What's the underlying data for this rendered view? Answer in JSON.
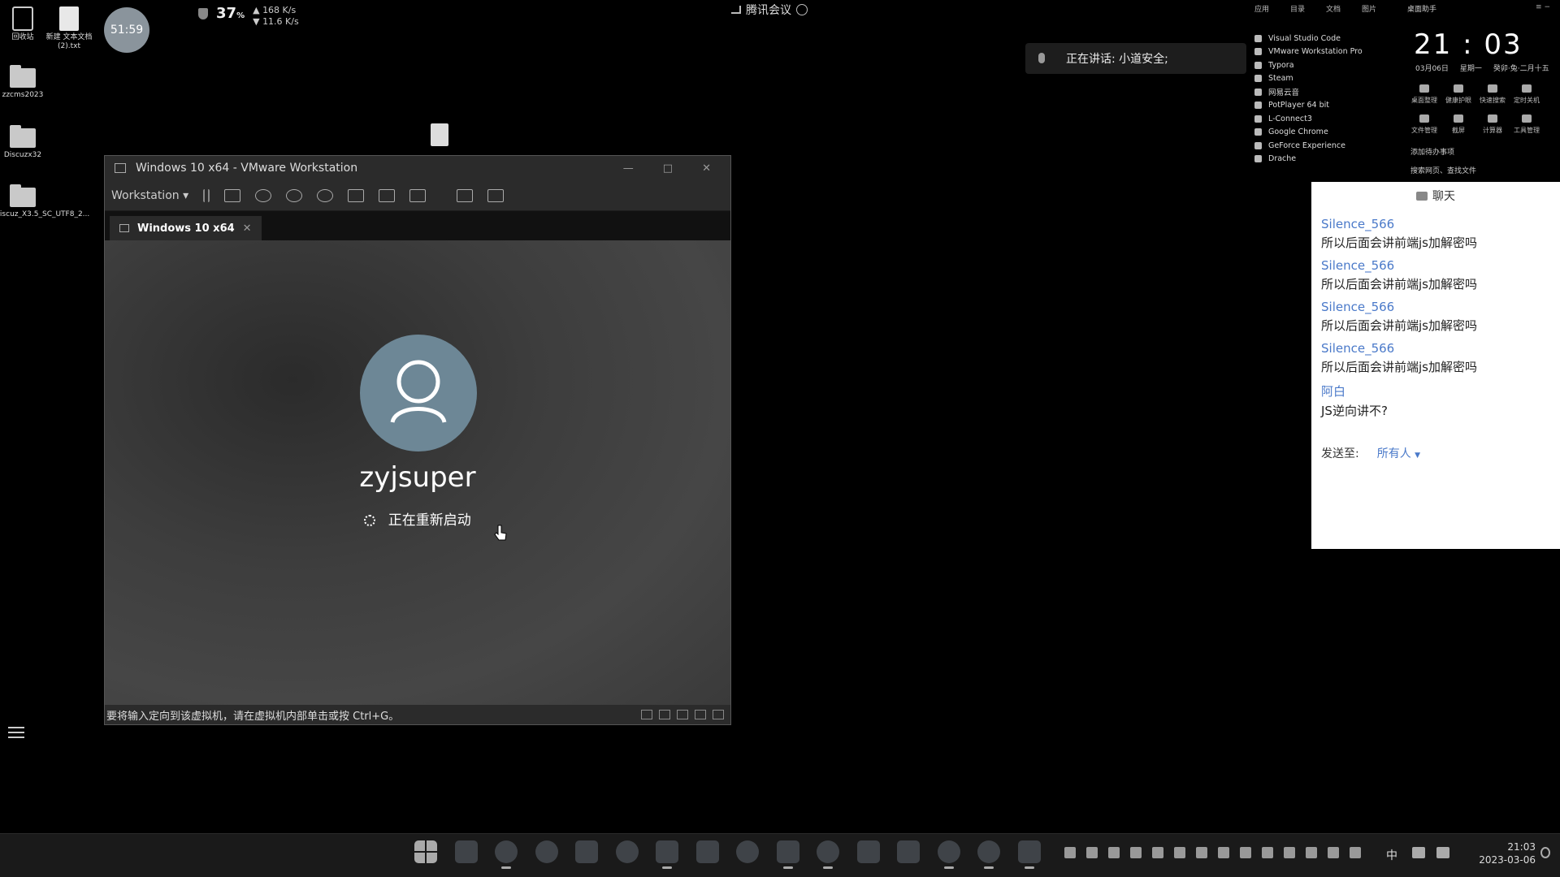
{
  "desktop": {
    "icons": [
      {
        "label": "回收站"
      },
      {
        "label": "新建 文本文档 (2).txt"
      },
      {
        "label": "zzcms2023"
      },
      {
        "label": "Discuzx32"
      },
      {
        "label": "Discuz_X3.5_SC_UTF8_2..."
      }
    ]
  },
  "monitor": {
    "clock_badge": "51:59",
    "cpu_percent": "37",
    "percent_sign": "%",
    "upload": "168 K/s",
    "download": "11.6 K/s"
  },
  "meeting": {
    "app_name": "腾讯会议",
    "speaking": "正在讲话: 小道安全;"
  },
  "applist": {
    "tabs": [
      "应用",
      "目录",
      "文档",
      "图片"
    ],
    "items": [
      "Visual Studio Code",
      "VMware Workstation Pro",
      "Typora",
      "Steam",
      "网易云音",
      "PotPlayer 64 bit",
      "L-Connect3",
      "Google Chrome",
      "GeForce Experience",
      "Drache"
    ]
  },
  "widget": {
    "title": "桌面助手",
    "time": "21 : 03",
    "date": "03月06日",
    "weekday": "星期一",
    "lunar": "癸卯·兔·二月十五",
    "buttons": [
      "桌面整理",
      "健康护眼",
      "快速搜索",
      "定时关机",
      "文件管理",
      "截屏",
      "计算器",
      "工具管理"
    ],
    "todo": "添加待办事项",
    "search": "搜索网页、查找文件"
  },
  "chat": {
    "title": "聊天",
    "messages": [
      {
        "name": "Silence_566",
        "text": "所以后面会讲前端js加解密吗"
      },
      {
        "name": "Silence_566",
        "text": "所以后面会讲前端js加解密吗"
      },
      {
        "name": "Silence_566",
        "text": "所以后面会讲前端js加解密吗"
      },
      {
        "name": "Silence_566",
        "text": "所以后面会讲前端js加解密吗"
      },
      {
        "name": "阿白",
        "text": "JS逆向讲不?"
      }
    ],
    "send_to_label": "发送至:",
    "send_to_value": "所有人"
  },
  "vmware": {
    "title": "Windows 10 x64 - VMware Workstation",
    "menu": "Workstation",
    "tab": "Windows 10 x64",
    "username": "zyjsuper",
    "status": "正在重新启动",
    "statusbar": "要将输入定向到该虚拟机，请在虚拟机内部单击或按 Ctrl+G。"
  },
  "desktop_file": {
    "label": ""
  },
  "taskbar": {
    "ime": "中",
    "time": "21:03",
    "date": "2023-03-06"
  }
}
